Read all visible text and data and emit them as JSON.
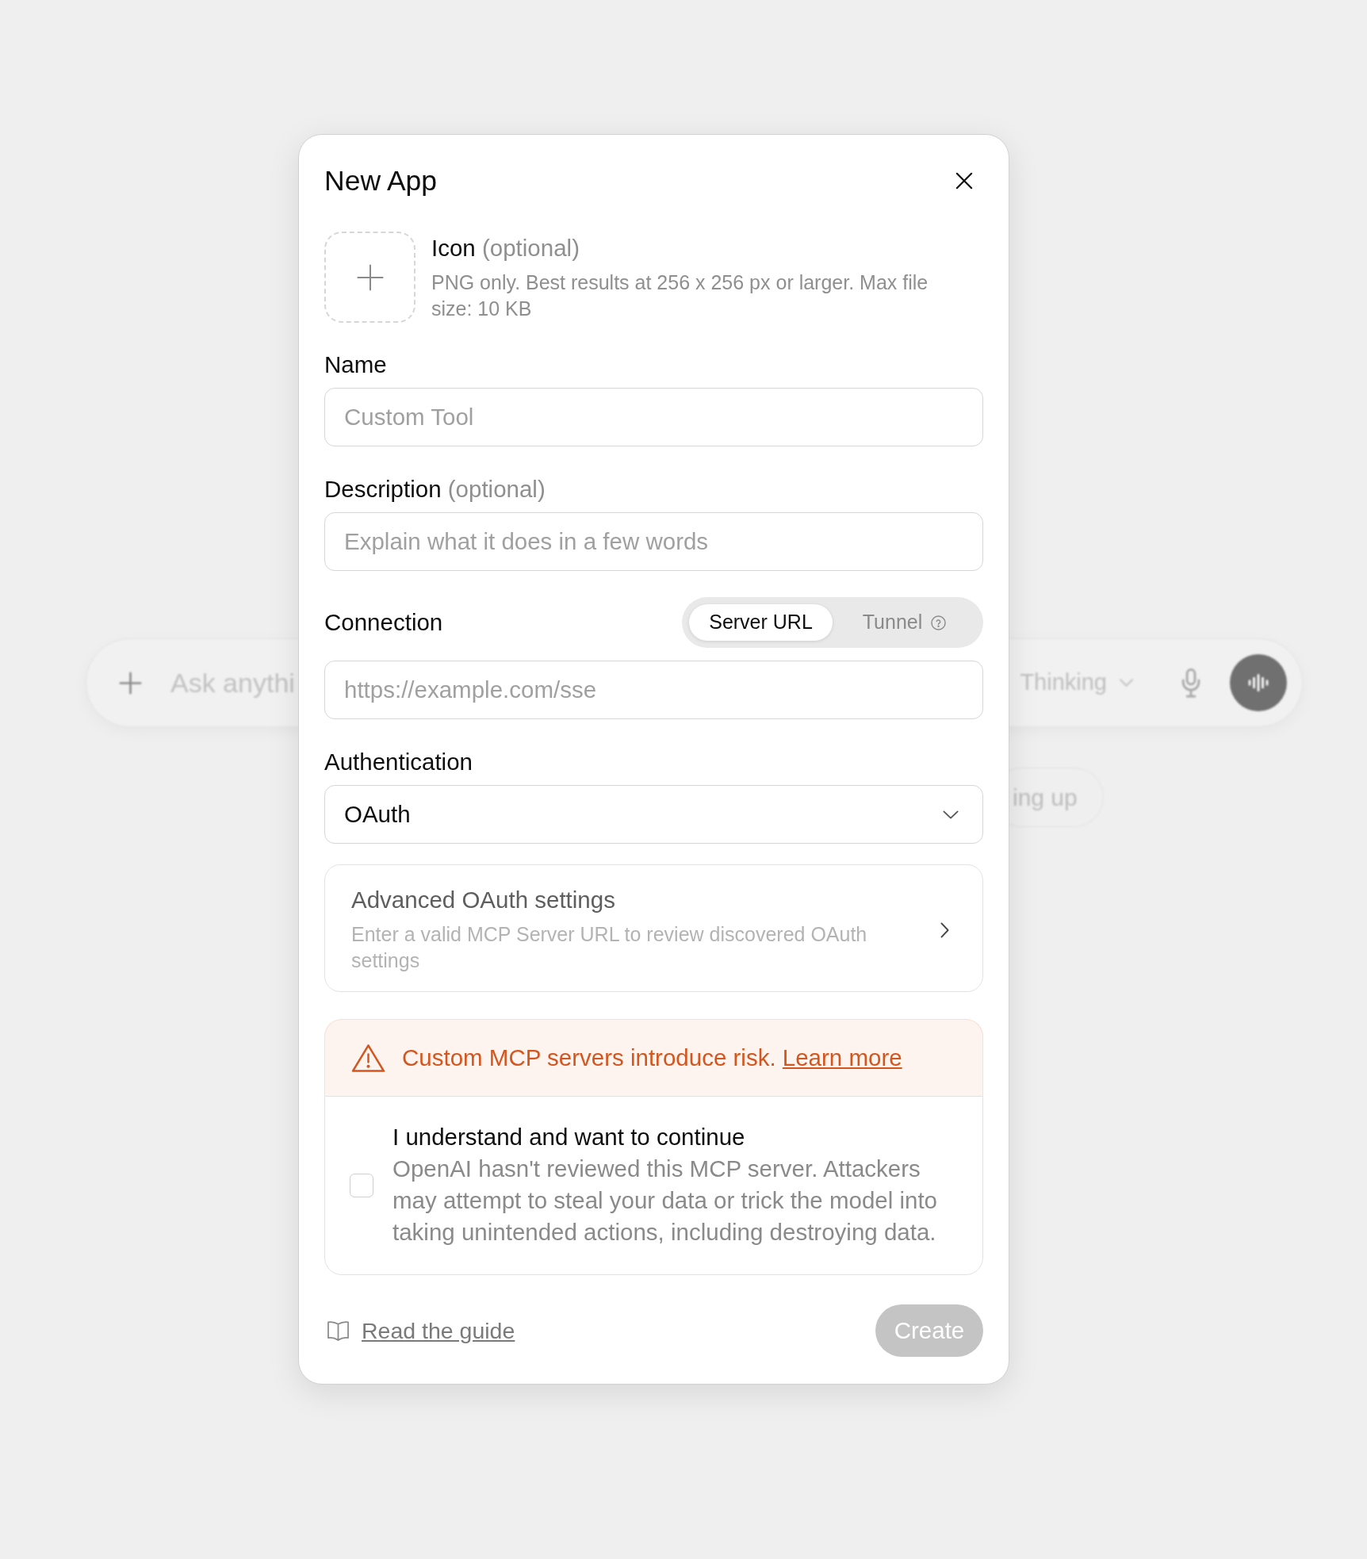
{
  "background": {
    "composer": {
      "placeholder": "Ask anythi",
      "model": "Thinking"
    },
    "suggestions": [
      {
        "label": "ing up"
      }
    ]
  },
  "dialog": {
    "title": "New App",
    "icon_upload": {
      "label": "Icon",
      "hint": "(optional)",
      "help": "PNG only. Best results at 256 x 256 px or larger. Max file size: 10 KB"
    },
    "fields": [
      {
        "label": "Name",
        "placeholder": "Custom Tool"
      },
      {
        "label": "Description",
        "hint": "(optional)",
        "placeholder": "Explain what it does in a few words"
      }
    ],
    "connection": {
      "label": "Connection",
      "options": [
        {
          "label": "Server URL",
          "selected": true,
          "info": false
        },
        {
          "label": "Tunnel",
          "selected": false,
          "info": true
        }
      ],
      "placeholder": "https://example.com/sse"
    },
    "authentication": {
      "label": "Authentication",
      "value": "OAuth"
    },
    "advanced": {
      "title": "Advanced OAuth settings",
      "description": "Enter a valid MCP Server URL to review discovered OAuth settings"
    },
    "warning": {
      "text": "Custom MCP servers introduce risk.",
      "link": "Learn more"
    },
    "consent": {
      "checked": false,
      "title": "I understand and want to continue",
      "description": "OpenAI hasn't reviewed this MCP server. Attackers may attempt to steal your data or trick the model into taking unintended actions, including destroying data."
    },
    "footer": {
      "guide_link": "Read the guide",
      "create_button": {
        "label": "Create",
        "disabled": true
      }
    }
  }
}
